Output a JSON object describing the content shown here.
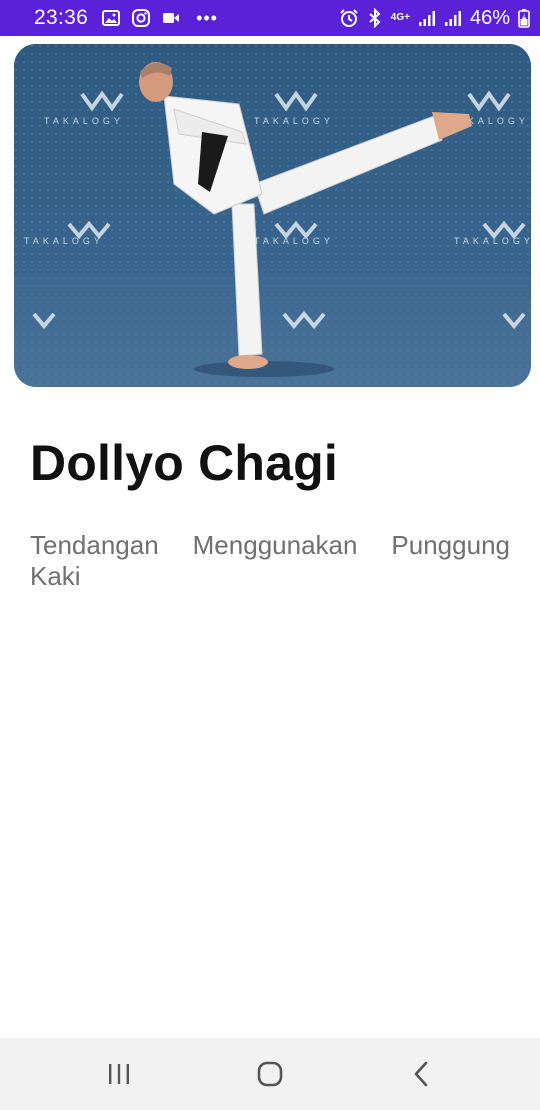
{
  "status_bar": {
    "time": "23:36",
    "network_label": "4G+",
    "battery_text": "46%",
    "background_color": "#5b21d9",
    "icons": [
      "gallery-icon",
      "instagram-icon",
      "video-icon",
      "more-dots",
      "alarm-icon",
      "bluetooth-icon",
      "signal-icon",
      "signal-icon",
      "battery-charging-icon"
    ],
    "more_dots": "•••"
  },
  "hero": {
    "watermark_text": "TAKALOGY"
  },
  "content": {
    "title": "Dollyo Chagi",
    "description": "Tendangan Menggunakan Punggung Kaki"
  },
  "nav_bar": {
    "icons": [
      "recent-apps-icon",
      "home-icon",
      "back-icon"
    ]
  }
}
